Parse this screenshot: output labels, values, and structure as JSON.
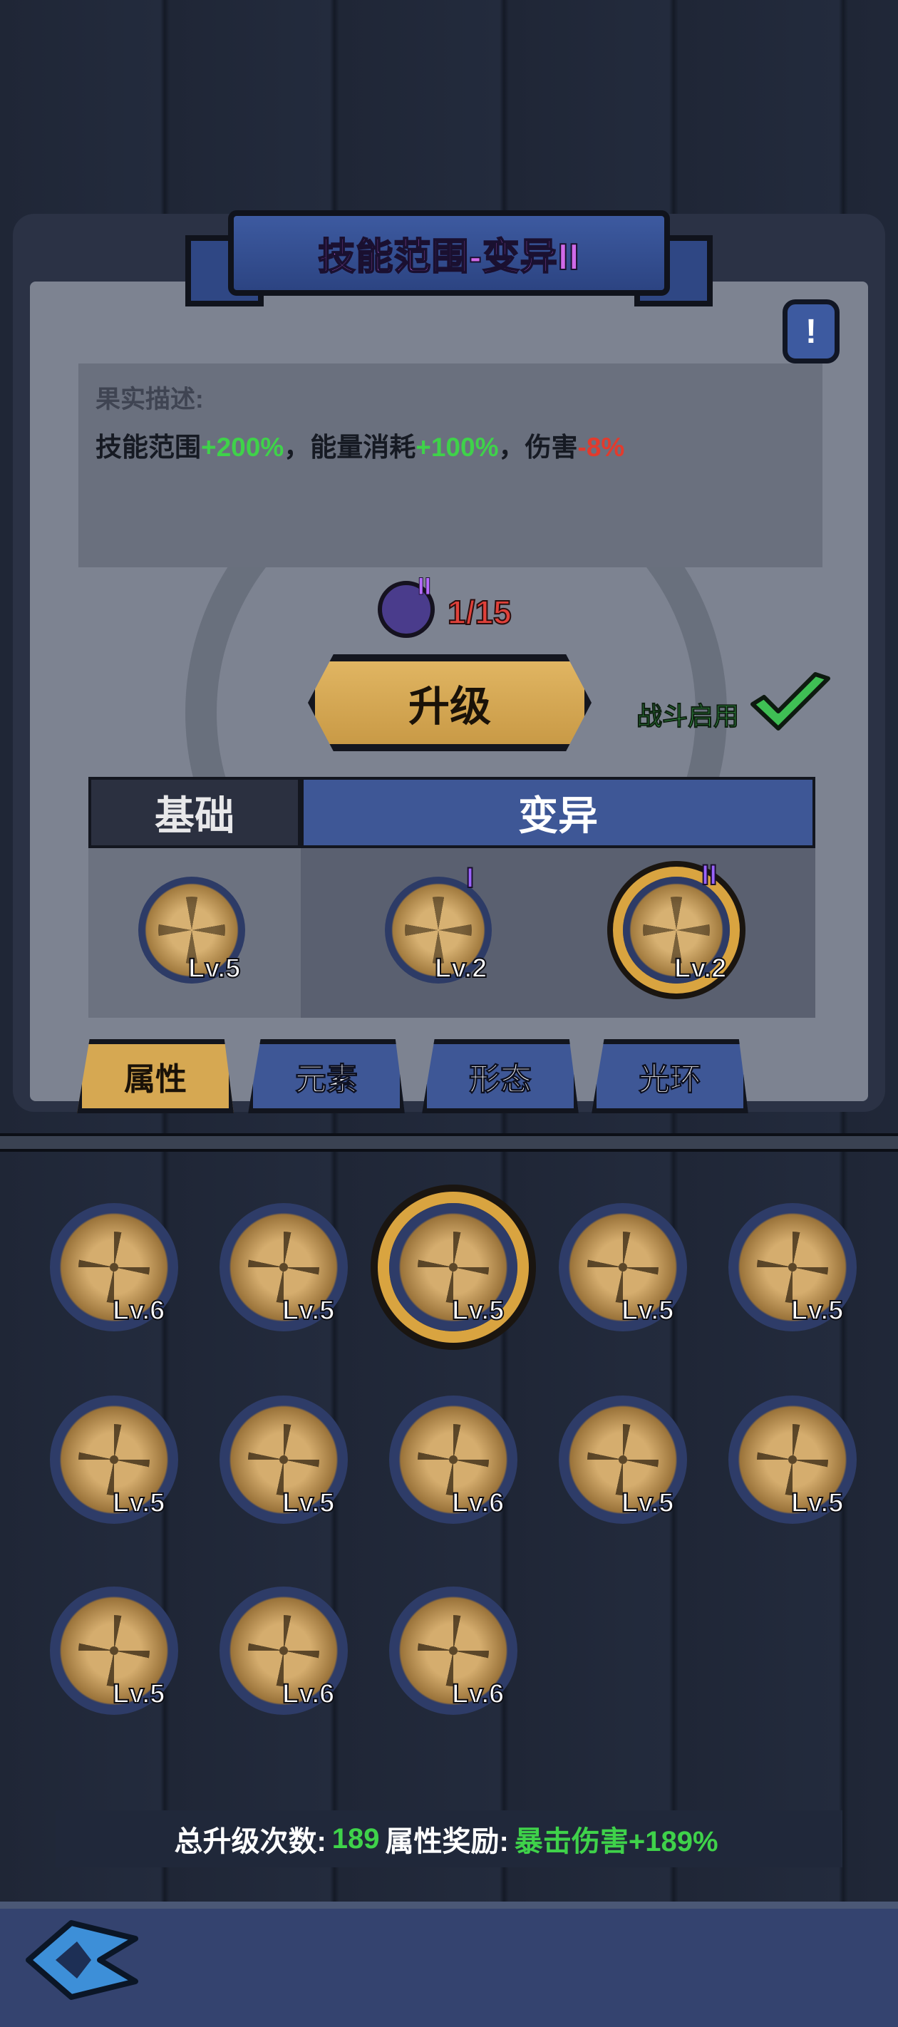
{
  "header": {
    "title": "技能范围-变异II",
    "info_label": "!"
  },
  "description": {
    "label": "果实描述:",
    "parts": [
      {
        "text": "技能范围",
        "tone": "normal"
      },
      {
        "text": "+200%",
        "tone": "good"
      },
      {
        "text": "，能量消耗",
        "tone": "normal"
      },
      {
        "text": "+100%",
        "tone": "good"
      },
      {
        "text": "，伤害",
        "tone": "normal"
      },
      {
        "text": "-8%",
        "tone": "bad"
      }
    ]
  },
  "progress": {
    "count": "1/15",
    "badge": "II"
  },
  "actions": {
    "upgrade_label": "升级",
    "battle_enable_label": "战斗启用",
    "battle_enabled": true
  },
  "variant_tabs": {
    "base_label": "基础",
    "mutation_label": "变异"
  },
  "variants": [
    {
      "level": "Lv.5",
      "roman": "",
      "selected": false
    },
    {
      "level": "Lv.2",
      "roman": "I",
      "selected": false
    },
    {
      "level": "Lv.2",
      "roman": "II",
      "selected": true
    }
  ],
  "category_tabs": [
    {
      "label": "属性",
      "active": true
    },
    {
      "label": "元素",
      "active": false
    },
    {
      "label": "形态",
      "active": false
    },
    {
      "label": "光环",
      "active": false
    }
  ],
  "skills": [
    {
      "icon": "arrows-up-icon",
      "level": "Lv.6",
      "selected": false
    },
    {
      "icon": "swirl-box-icon",
      "level": "Lv.5",
      "selected": false
    },
    {
      "icon": "expand-arrows-icon",
      "level": "Lv.5",
      "selected": true
    },
    {
      "icon": "spiral-jar-icon",
      "level": "Lv.5",
      "selected": false
    },
    {
      "icon": "chevrons-right-icon",
      "level": "Lv.5",
      "selected": false
    },
    {
      "icon": "impact-ring-icon",
      "level": "Lv.5",
      "selected": false
    },
    {
      "icon": "broken-heart-icon",
      "level": "Lv.5",
      "selected": false
    },
    {
      "icon": "heart-plus-icon",
      "level": "Lv.6",
      "selected": false
    },
    {
      "icon": "rising-wave-icon",
      "level": "Lv.5",
      "selected": false
    },
    {
      "icon": "beam-fan-icon",
      "level": "Lv.5",
      "selected": false
    },
    {
      "icon": "burst-icon",
      "level": "Lv.5",
      "selected": false
    },
    {
      "icon": "shatter-icon",
      "level": "Lv.6",
      "selected": false
    },
    {
      "icon": "lightning-icon",
      "level": "Lv.6",
      "selected": false
    }
  ],
  "summary": {
    "total_label": "总升级次数:",
    "total_value": "189",
    "bonus_label": "属性奖励:",
    "bonus_value": "暴击伤害+189%"
  },
  "colors": {
    "accent_gold": "#d6a852",
    "accent_blue": "#3e5796",
    "good": "#3fd24a",
    "bad": "#e23b2d",
    "title": "#d06ae8"
  }
}
